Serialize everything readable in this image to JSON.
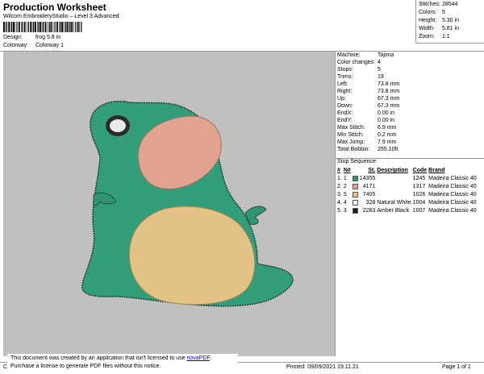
{
  "header": {
    "title": "Production Worksheet",
    "subtitle": "Wilcom EmbroideryStudio – Level 3 Advanced",
    "design_label": "Design:",
    "design_value": "frog 5.8 in",
    "colorway_label": "Colorway:",
    "colorway_value": "Colorway 1"
  },
  "stats": [
    {
      "label": "Stitches:",
      "value": "28544"
    },
    {
      "label": "Colors:",
      "value": "5"
    },
    {
      "label": "Height:",
      "value": "5.30 in"
    },
    {
      "label": "Width:",
      "value": "5.81 in"
    },
    {
      "label": "Zoom:",
      "value": "1:1"
    }
  ],
  "machine_info": [
    {
      "label": "Machine:",
      "value": "Tajima"
    },
    {
      "label": "Color changes:",
      "value": "4"
    },
    {
      "label": "Stops:",
      "value": "5"
    },
    {
      "label": "Trims:",
      "value": "19"
    },
    {
      "label": "Left:",
      "value": "73.8 mm"
    },
    {
      "label": "Right:",
      "value": "73.8 mm"
    },
    {
      "label": "Up:",
      "value": "67.3 mm"
    },
    {
      "label": "Down:",
      "value": "67.3 mm"
    },
    {
      "label": "EndX:",
      "value": "0.00 in"
    },
    {
      "label": "EndY:",
      "value": "0.00 in"
    },
    {
      "label": "Max Stitch:",
      "value": "6.9 mm"
    },
    {
      "label": "Min Stitch:",
      "value": "0.2 mm"
    },
    {
      "label": "Max Jump:",
      "value": "7.9 mm"
    },
    {
      "label": "Total Bobbin:",
      "value": "255.10ft"
    }
  ],
  "stop_sequence": {
    "title": "Stop Sequence:",
    "headers": [
      "#",
      "N#",
      "",
      "St.",
      "Description",
      "Code",
      "Brand"
    ],
    "rows": [
      {
        "num": "1.",
        "n": "1",
        "color": "#1f9a78",
        "st": "14355",
        "desc": "",
        "code": "1245",
        "brand": "Madeira Classic 40"
      },
      {
        "num": "2.",
        "n": "2",
        "color": "#e7a08c",
        "st": "4171",
        "desc": "",
        "code": "1317",
        "brand": "Madeira Classic 40"
      },
      {
        "num": "3.",
        "n": "5",
        "color": "#f2c48a",
        "st": "7405",
        "desc": "",
        "code": "1026",
        "brand": "Madeira Classic 40"
      },
      {
        "num": "4.",
        "n": "4",
        "color": "#f4f4f4",
        "st": "328",
        "desc": "Natural White",
        "code": "1004",
        "brand": "Madeira Classic 40"
      },
      {
        "num": "5.",
        "n": "3",
        "color": "#1f1f1f",
        "st": "2283",
        "desc": "Amber Black",
        "code": "1007",
        "brand": "Madeira Classic 40"
      }
    ]
  },
  "footer": {
    "left": "Cr",
    "printed": "Printed: 09/09/2021 19.11.21",
    "page": "Page 1 of 1"
  },
  "notice": {
    "line1_prefix": "This document was created by an application that isn't licensed to use ",
    "link": "novaPDF",
    "line1_suffix": ".",
    "line2": "Purchase a license to generate PDF files without this notice."
  },
  "colors": {
    "frog_green": "#33a07c",
    "mouth_pink": "#e0a390",
    "belly_tan": "#e3c285",
    "background_gray": "#c0c0c0"
  }
}
